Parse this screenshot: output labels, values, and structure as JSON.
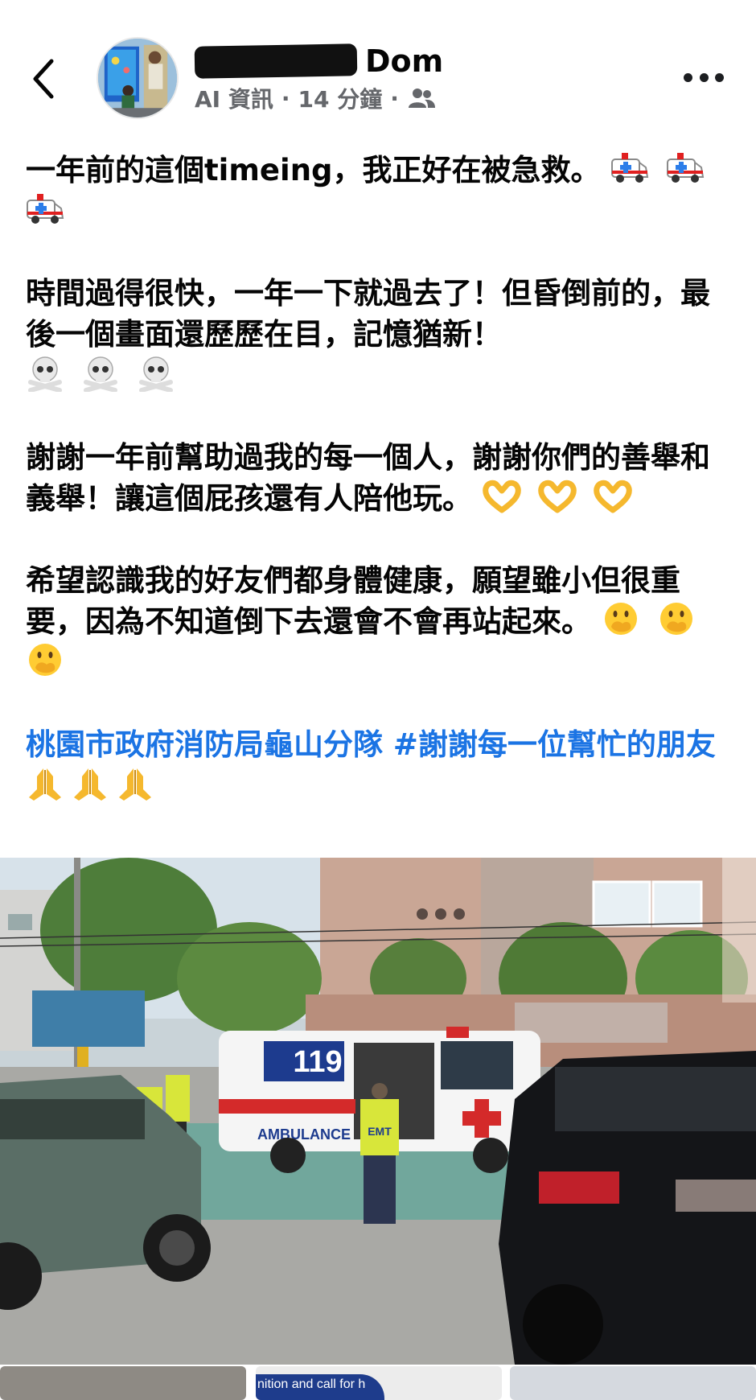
{
  "header": {
    "name_suffix": "Dom",
    "meta_source": "AI 資訊",
    "meta_time": "14 分鐘",
    "meta_sep": "·"
  },
  "post": {
    "p1": "一年前的這個timeing，我正好在被急救。",
    "p2": "時間過得很快，一年一下就過去了！但昏倒前的，最後一個畫面還歷歷在目，記憶猶新！",
    "p3": "謝謝一年前幫助過我的每一個人，謝謝你們的善舉和義舉！讓這個屁孩還有人陪他玩。",
    "p4": "希望認識我的好友們都身體健康，願望雖小但很重要，因為不知道倒下去還會不會再站起來。",
    "p5": "桃園市政府消防局龜山分隊 #謝謝每一位幫忙的朋友"
  },
  "photo": {
    "ambulance_number": "119",
    "ambulance_label": "AMBULANCE",
    "vest_text": "EMT"
  },
  "thumbs": {
    "t2_text": "nition and call for h"
  },
  "icons": {
    "p1": "ambulance-emoji",
    "p2": "skull-crossbones-emoji",
    "p3": "heart-hands-emoji",
    "p4": "face-hand-over-mouth-emoji",
    "p5": "folded-hands-emoji"
  },
  "colors": {
    "link": "#1b74e4",
    "meta": "#65676b",
    "text": "#050505"
  }
}
